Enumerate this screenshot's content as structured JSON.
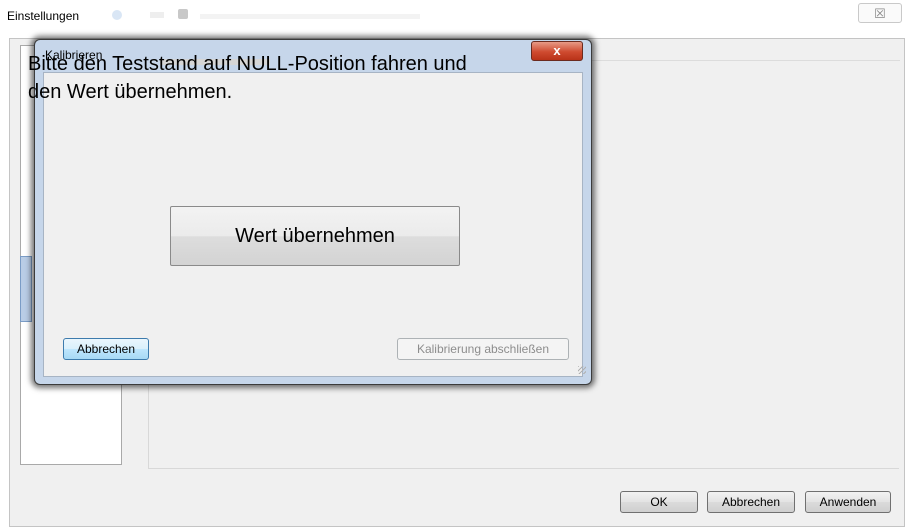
{
  "outer_window": {
    "title": "Einstellungen",
    "close_glyph": "☒",
    "buttons": {
      "ok": "OK",
      "cancel": "Abbrechen",
      "apply": "Anwenden"
    }
  },
  "dialog": {
    "title": "Kalibrieren",
    "close_glyph": "x",
    "message_line1": "Bitte den Teststand auf NULL-Position fahren und",
    "message_line2": "den Wert übernehmen.",
    "take_value_button": "Wert übernehmen",
    "cancel_button": "Abbrechen",
    "finish_button": "Kalibrierung abschließen"
  },
  "colors": {
    "dialog_frame": "#c6d6ea",
    "close_button": "#cf4b30",
    "focused_button": "#3d7bad"
  },
  "icons": {
    "outer_close": "close-icon",
    "dialog_close": "close-icon",
    "resize_grip": "resize-grip-icon"
  }
}
